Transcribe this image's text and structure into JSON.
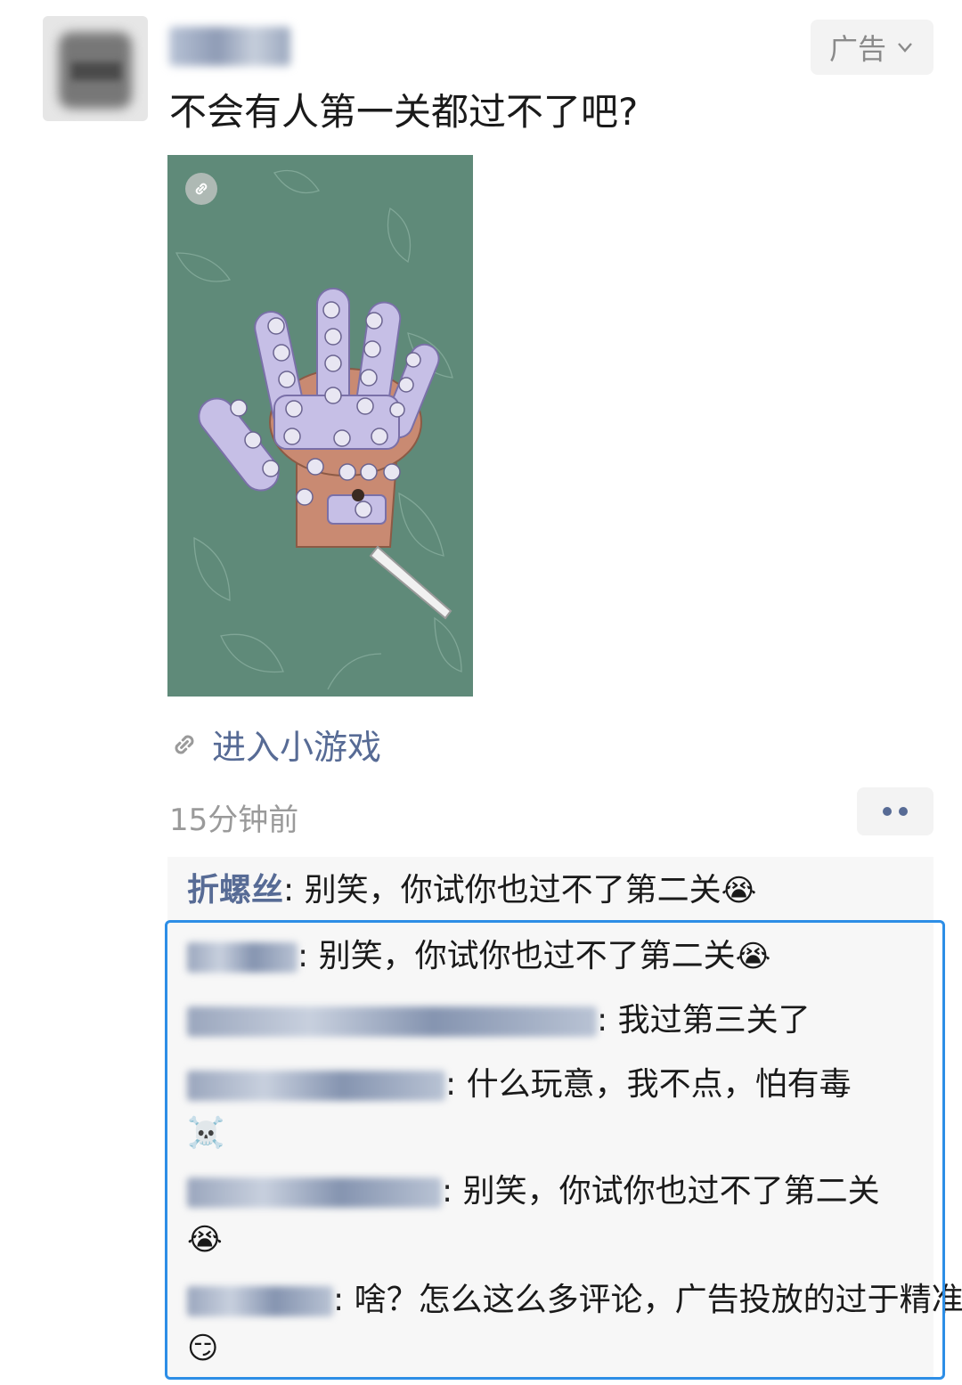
{
  "post": {
    "ad_label": "广告",
    "text": "不会有人第一关都过不了吧?",
    "mini_game_link": "进入小游戏",
    "time": "15分钟前"
  },
  "comments": [
    {
      "author": "折螺丝",
      "author_visible": true,
      "text": "别笑，你试你也过不了第二关",
      "emoji": "😭"
    },
    {
      "author_visible": false,
      "text": "别笑，你试你也过不了第二关",
      "emoji": "😭"
    },
    {
      "author_visible": false,
      "text": "我过第三关了"
    },
    {
      "author_visible": false,
      "text": "什么玩意，我不点，怕有毒",
      "emoji": "☠️"
    },
    {
      "author_visible": false,
      "text": "别笑，你试你也过不了第二关",
      "emoji": "😭"
    },
    {
      "author_visible": false,
      "text": "啥？怎么这么多评论，广告投放的过于精准？",
      "emoji": "😏"
    }
  ],
  "icons": {
    "ad_chevron": "chevron-down-icon",
    "link": "link-icon",
    "more": "more-dots-icon"
  },
  "colors": {
    "link_blue": "#576b95",
    "highlight_border": "#2d8ee6",
    "card_bg": "#5f8a79"
  }
}
